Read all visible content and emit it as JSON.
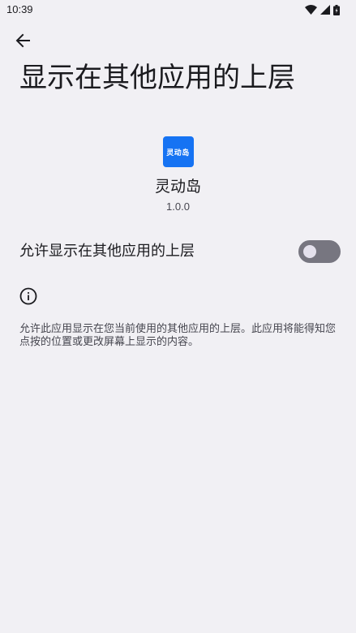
{
  "status_bar": {
    "time": "10:39",
    "icons": [
      "wifi-icon",
      "cellular-signal-icon",
      "battery-icon"
    ]
  },
  "header": {
    "back_icon": "arrow-back-icon",
    "title": "显示在其他应用的上层"
  },
  "app": {
    "icon_text": "灵动岛",
    "icon_color": "#1673f3",
    "name": "灵动岛",
    "version": "1.0.0"
  },
  "permission": {
    "label": "允许显示在其他应用的上层",
    "enabled": false
  },
  "info": {
    "icon": "info-icon",
    "text": "允许此应用显示在您当前使用的其他应用的上层。此应用将能得知您点按的位置或更改屏幕上显示的内容。"
  },
  "colors": {
    "background": "#f1f0f4",
    "text_primary": "#1b1b1f",
    "text_secondary": "#46464f",
    "switch_off_track": "#777680",
    "switch_off_thumb": "#e4e1ec"
  }
}
